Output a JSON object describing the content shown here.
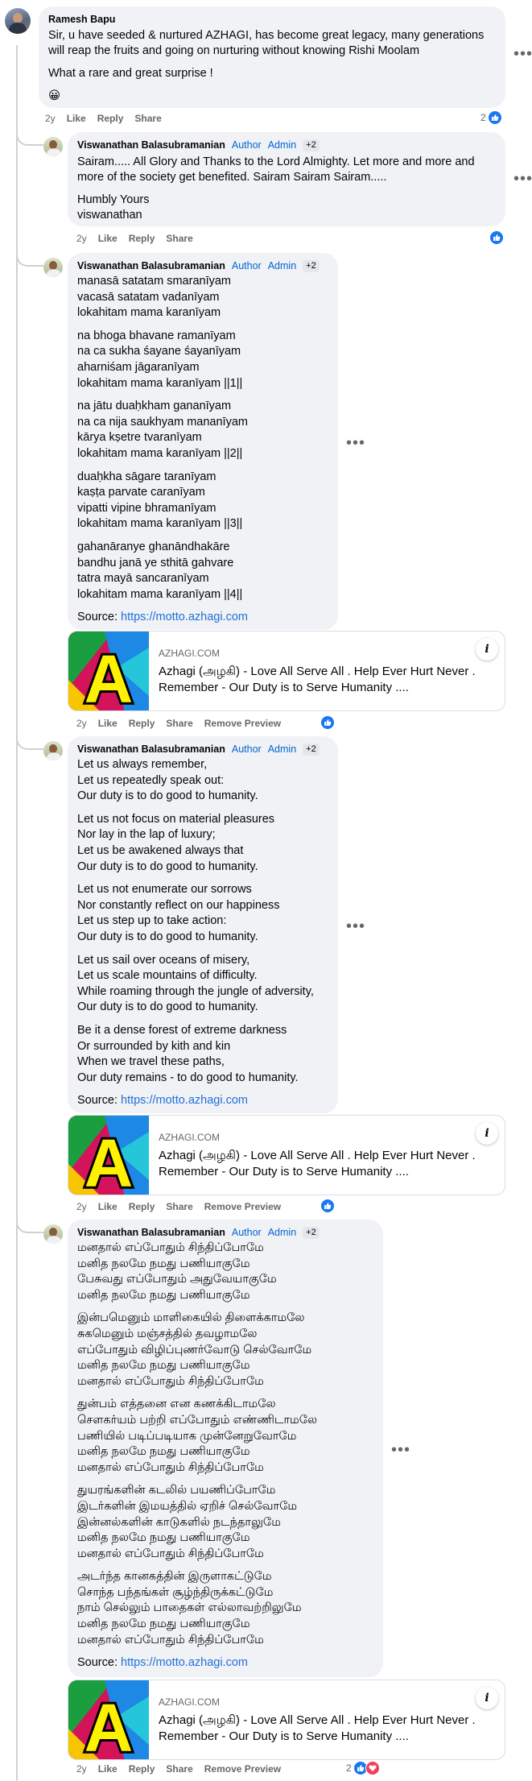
{
  "actions": {
    "time": "2y",
    "like": "Like",
    "reply": "Reply",
    "share": "Share",
    "remove_preview": "Remove Preview"
  },
  "more": "•••",
  "comment1": {
    "author": "Ramesh Bapu",
    "paras": [
      [
        "Sir, u have seeded & nurtured AZHAGI, has become great legacy, many generations",
        "will reap the fruits and going on nurturing without knowing Rishi Moolam"
      ],
      [
        "What a rare and great surprise !"
      ]
    ],
    "emoji": "😀",
    "reaction_count": "2"
  },
  "reply_author": {
    "name": "Viswanathan Balasubramanian",
    "author_badge": "Author",
    "admin_badge": "Admin",
    "plus": "+2"
  },
  "reply1": {
    "paras": [
      [
        "Sairam..... All Glory and Thanks to the Lord Almighty. Let more and more and",
        "more of the society get benefited. Sairam Sairam Sairam....."
      ],
      [
        "Humbly Yours",
        "viswanathan"
      ]
    ]
  },
  "reply2": {
    "paras": [
      [
        "manasā satatam smaranīyam",
        "vacasā satatam vadanīyam",
        "lokahitam mama karanīyam"
      ],
      [
        "na bhoga bhavane ramanīyam",
        "na ca sukha śayane śayanīyam",
        "aharniśam jāgaranīyam",
        "lokahitam mama karanīyam ||1||"
      ],
      [
        "na jātu duaḥkham gananīyam",
        "na ca nija saukhyam mananīyam",
        "kārya kṣetre tvaranīyam",
        "lokahitam mama karanīyam ||2||"
      ],
      [
        "duaḥkha sāgare taranīyam",
        "kaṣṭa parvate caranīyam",
        "vipatti vipine bhramanīyam",
        "lokahitam mama karanīyam ||3||"
      ],
      [
        "gahanāranye ghanāndhakāre",
        "bandhu janā ye sthitā gahvare",
        "tatra mayā sancaranīyam",
        "lokahitam mama karanīyam ||4||"
      ]
    ],
    "source_label": "Source: ",
    "source_link": "https://motto.azhagi.com"
  },
  "reply3": {
    "paras": [
      [
        "Let us always remember,",
        "Let us repeatedly speak out:",
        "Our duty is to do good to humanity."
      ],
      [
        "Let us not focus on material pleasures",
        "Nor lay in the lap of luxury;",
        "Let us be awakened always that",
        "Our duty is to do good to humanity."
      ],
      [
        "Let us not enumerate our sorrows",
        "Nor constantly reflect on our happiness",
        "Let us step up to take action:",
        "Our duty is to do good to humanity."
      ],
      [
        "Let us sail over oceans of misery,",
        "Let us scale mountains of difficulty.",
        "While roaming through the jungle of adversity,",
        "Our duty is to do good to humanity."
      ],
      [
        "Be it a dense forest of extreme darkness",
        "Or surrounded by kith and kin",
        "When we travel these paths,",
        "Our duty remains - to do good to humanity."
      ]
    ],
    "source_label": "Source: ",
    "source_link": "https://motto.azhagi.com"
  },
  "reply4": {
    "paras": [
      [
        "மனதால் எப்போதும் சிந்திப்போமே",
        "மனித நலமே நமது பணியாகுமே",
        "பேசுவது எப்போதும் அதுவேயாகுமே",
        "மனித நலமே நமது பணியாகுமே"
      ],
      [
        "இன்பமெனும் மாளிகையில் திளைக்காமலே",
        "சுகமெனும் மஞ்சத்தில் தவழாமலே",
        "எப்போதும் விழிப்புணர்வோடு செல்வோமே",
        "மனித நலமே நமது பணியாகுமே",
        "மனதால் எப்போதும் சிந்திப்போமே"
      ],
      [
        "துன்பம் எத்தனை என கணக்கிடாமலே",
        "சௌகர்யம் பற்றி எப்போதும் எண்ணிடாமலே",
        "பணியில் படிப்படியாக முன்னேறுவோமே",
        "மனித நலமே நமது பணியாகுமே",
        "மனதால் எப்போதும் சிந்திப்போமே"
      ],
      [
        "துயரங்களின் கடலில் பயணிப்போமே",
        "இடர்களின் இமயத்தில் ஏறிச் செல்வோமே",
        "இன்னல்களின் காடுகளில் நடந்தாலுமே",
        "மனித நலமே நமது பணியாகுமே",
        "மனதால் எப்போதும் சிந்திப்போமே"
      ],
      [
        "அடர்ந்த கானகத்தின் இருளாகட்டுமே",
        "சொந்த பந்தங்கள் சூழ்ந்திருக்கட்டுமே",
        "நாம் செல்லும் பாதைகள் எல்லாவற்றிலுமே",
        "மனித நலமே நமது பணியாகுமே",
        "மனதால் எப்போதும் சிந்திப்போமே"
      ]
    ],
    "source_label": "Source: ",
    "source_link": "https://motto.azhagi.com",
    "reaction_count": "2"
  },
  "link_preview": {
    "site": "AZHAGI.COM",
    "title": "Azhagi (அழகி) - Love All Serve All . Help Ever Hurt Never . Remember - Our Duty is to Serve Humanity ....",
    "logo_letter": "A",
    "info_glyph": "i"
  },
  "colors": {
    "link": "#216fdb",
    "badge": "#0064d1",
    "like": "#1877f2",
    "love": "#f33e58",
    "bubble": "#f0f2f5"
  }
}
